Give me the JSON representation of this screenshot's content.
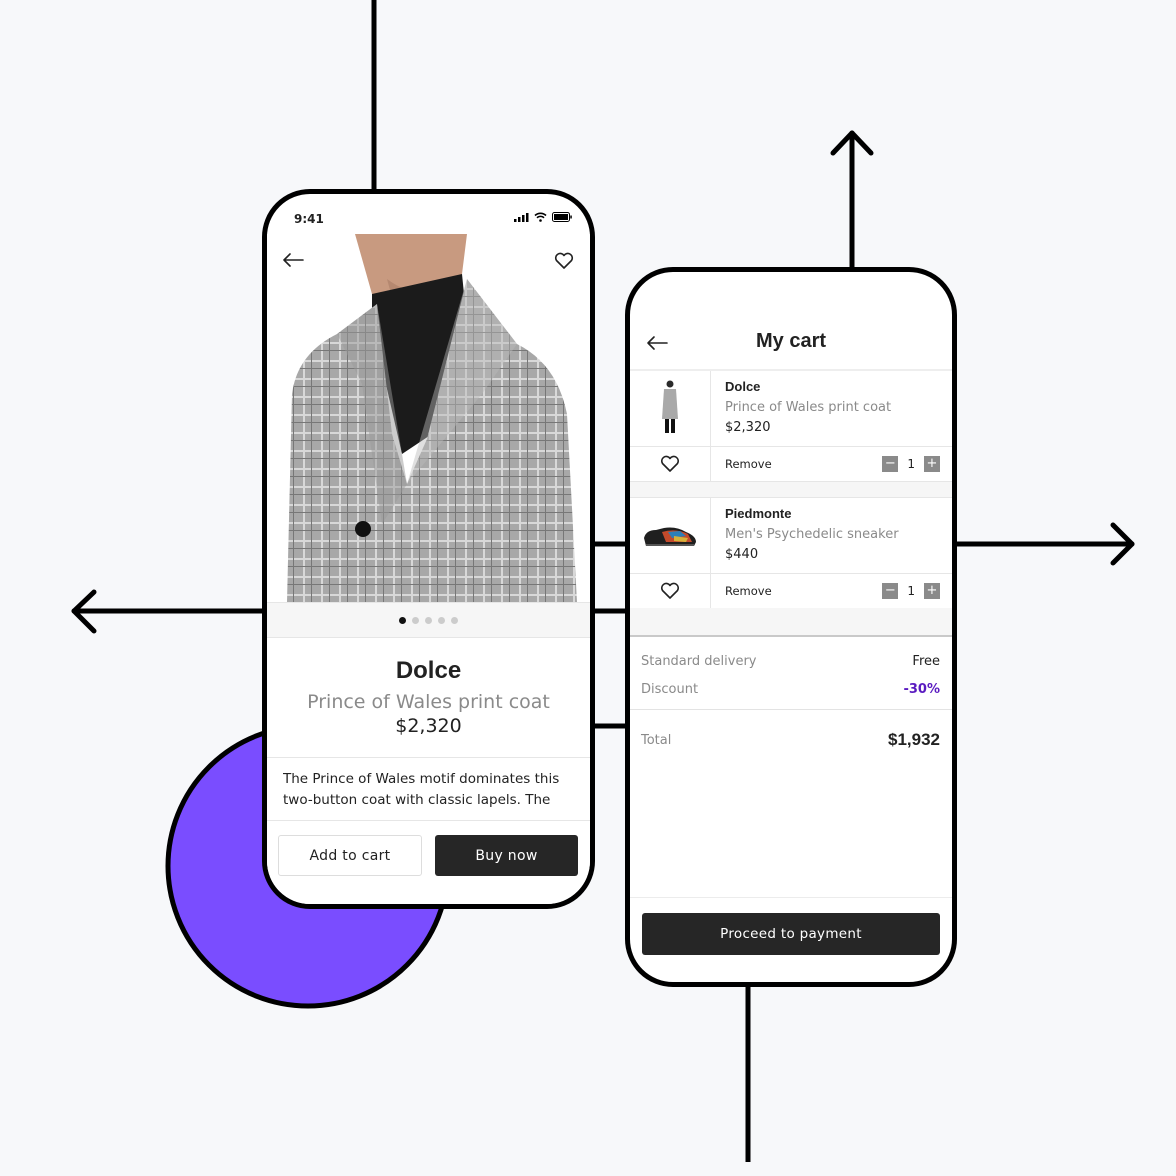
{
  "colors": {
    "accent_circle": "#7a4dff",
    "dark_button": "#262626",
    "discount": "#5a1bc0",
    "background": "#f7f8fa"
  },
  "product_screen": {
    "status_time": "9:41",
    "status_icons": [
      "signal-icon",
      "wifi-icon",
      "battery-icon"
    ],
    "back_icon": "arrow-left-icon",
    "favorite_icon": "heart-icon",
    "carousel": {
      "total": 5,
      "active": 1
    },
    "brand": "Dolce",
    "name": "Prince of Wales print coat",
    "price": "$2,320",
    "description": "The Prince of Wales motif dominates this two-button coat with classic lapels. The",
    "add_to_cart_label": "Add to cart",
    "buy_now_label": "Buy now"
  },
  "cart_screen": {
    "title": "My cart",
    "back_icon": "arrow-left-icon",
    "items": [
      {
        "brand": "Dolce",
        "name": "Prince of Wales print coat",
        "price": "$2,320",
        "remove_label": "Remove",
        "quantity": "1",
        "minus": "−",
        "plus": "+"
      },
      {
        "brand": "Piedmonte",
        "name": "Men's Psychedelic sneaker",
        "price": "$440",
        "remove_label": "Remove",
        "quantity": "1",
        "minus": "−",
        "plus": "+"
      }
    ],
    "summary": {
      "delivery_label": "Standard delivery",
      "delivery_value": "Free",
      "discount_label": "Discount",
      "discount_value": "-30%",
      "total_label": "Total",
      "total_value": "$1,932"
    },
    "pay_label": "Proceed to payment"
  }
}
